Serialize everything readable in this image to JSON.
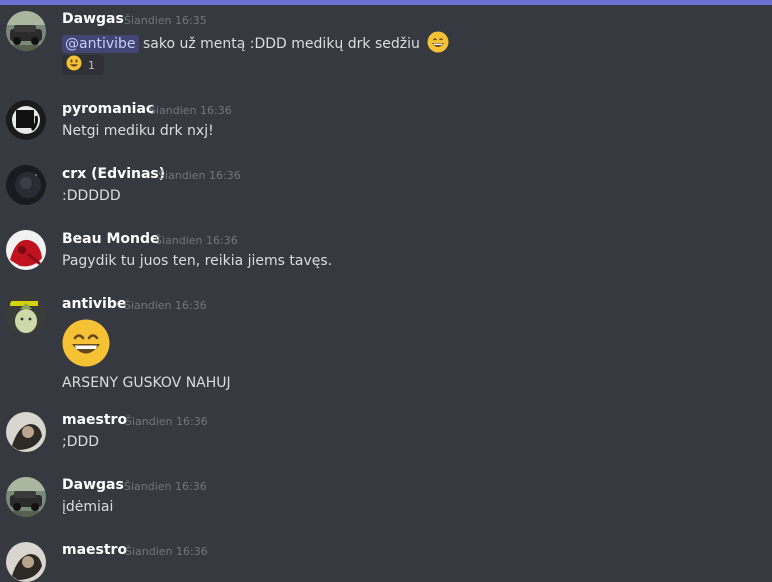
{
  "messages": [
    {
      "author": "Dawgas",
      "time": "Šiandien 16:35",
      "mention": "@antivibe",
      "text": "sako už mentą :DDD medikų drk sedžiu",
      "inline_emoji": "grinning-face",
      "reaction": {
        "emoji": "smiley-face",
        "count": "1"
      }
    },
    {
      "author": "pyromaniac",
      "time": "Šiandien 16:36",
      "text": "Netgi mediku drk nxj!"
    },
    {
      "author": "crx (Edvinas)",
      "time": "Šiandien 16:36",
      "text": ":DDDDD"
    },
    {
      "author": "Beau Monde",
      "time": "Šiandien 16:36",
      "text": "Pagydik tu juos ten, reikia jiems tavęs."
    },
    {
      "author": "antivibe",
      "time": "Šiandien 16:36",
      "big_emoji": "grinning-face",
      "text": "ARSENY GUSKOV NAHUJ"
    },
    {
      "author": "maestro",
      "time": "Šiandien 16:36",
      "text": ";DDD"
    },
    {
      "author": "Dawgas",
      "time": "Šiandien 16:36",
      "text": "įdėmiai"
    },
    {
      "author": "maestro",
      "time": "Šiandien 16:36"
    }
  ],
  "colors": {
    "background": "#36393f",
    "accent": "#6a6fd0",
    "mention_bg": "#414675",
    "emoji": "#f6c235"
  }
}
